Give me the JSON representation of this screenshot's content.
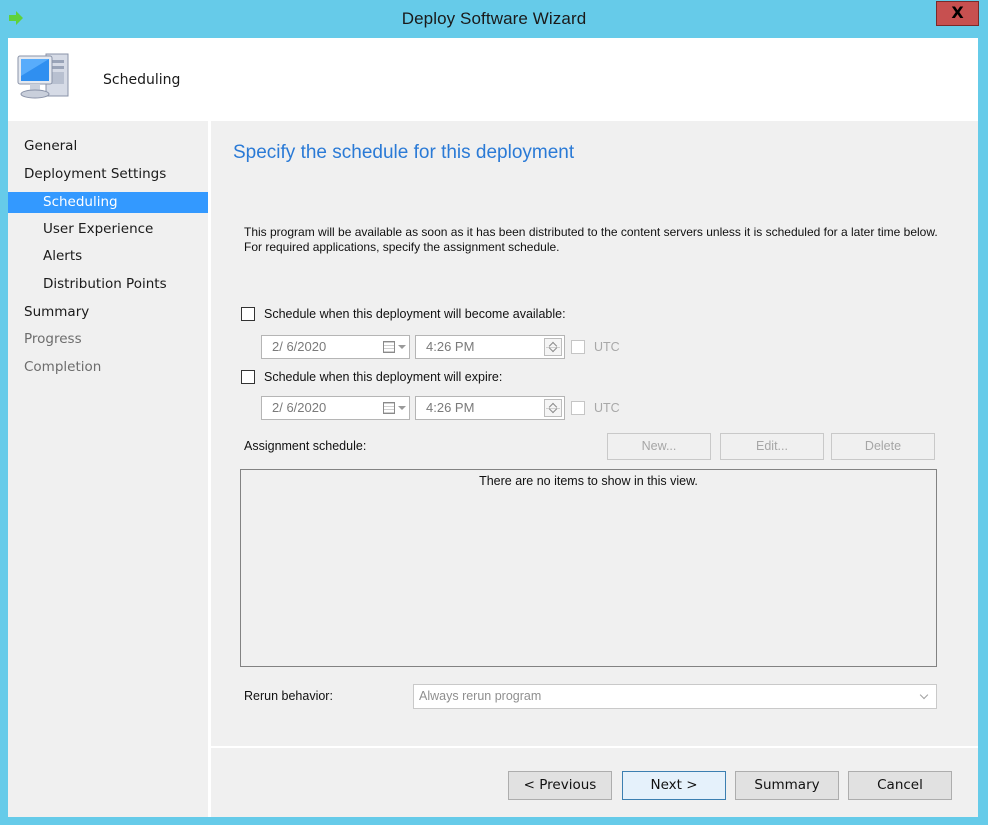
{
  "window": {
    "title": "Deploy Software Wizard",
    "close_label": "X",
    "app_icon": "green-arrow-icon"
  },
  "banner": {
    "icon": "computer-icon",
    "title": "Scheduling"
  },
  "sidebar": {
    "items": [
      {
        "label": "General",
        "level": 0,
        "state": "normal"
      },
      {
        "label": "Deployment Settings",
        "level": 0,
        "state": "normal"
      },
      {
        "label": "Scheduling",
        "level": 1,
        "state": "selected"
      },
      {
        "label": "User Experience",
        "level": 1,
        "state": "normal"
      },
      {
        "label": "Alerts",
        "level": 1,
        "state": "normal"
      },
      {
        "label": "Distribution Points",
        "level": 1,
        "state": "normal"
      },
      {
        "label": "Summary",
        "level": 0,
        "state": "normal"
      },
      {
        "label": "Progress",
        "level": 0,
        "state": "disabled"
      },
      {
        "label": "Completion",
        "level": 0,
        "state": "disabled"
      }
    ]
  },
  "main": {
    "heading": "Specify the schedule for this deployment",
    "intro": "This program will be available as soon as it has been distributed to the content servers unless it is scheduled for a later time below. For required applications, specify the assignment schedule.",
    "available": {
      "label": "Schedule when this deployment will become available:",
      "checked": false,
      "date": "2/ 6/2020",
      "time": "4:26 PM",
      "utc_label": "UTC",
      "utc_checked": false
    },
    "expire": {
      "label": "Schedule when this deployment will expire:",
      "checked": false,
      "date": "2/ 6/2020",
      "time": "4:26 PM",
      "utc_label": "UTC",
      "utc_checked": false
    },
    "assignment": {
      "label": "Assignment schedule:",
      "new_label": "New...",
      "edit_label": "Edit...",
      "delete_label": "Delete",
      "empty_message": "There are no items to show in this view."
    },
    "rerun": {
      "label": "Rerun behavior:",
      "value": "Always rerun program"
    }
  },
  "footer": {
    "previous_label": "< Previous",
    "next_label": "Next >",
    "summary_label": "Summary",
    "cancel_label": "Cancel"
  },
  "colors": {
    "frame": "#66cbe9",
    "selection": "#3399ff",
    "heading": "#2a7ad6",
    "close": "#c75050"
  }
}
